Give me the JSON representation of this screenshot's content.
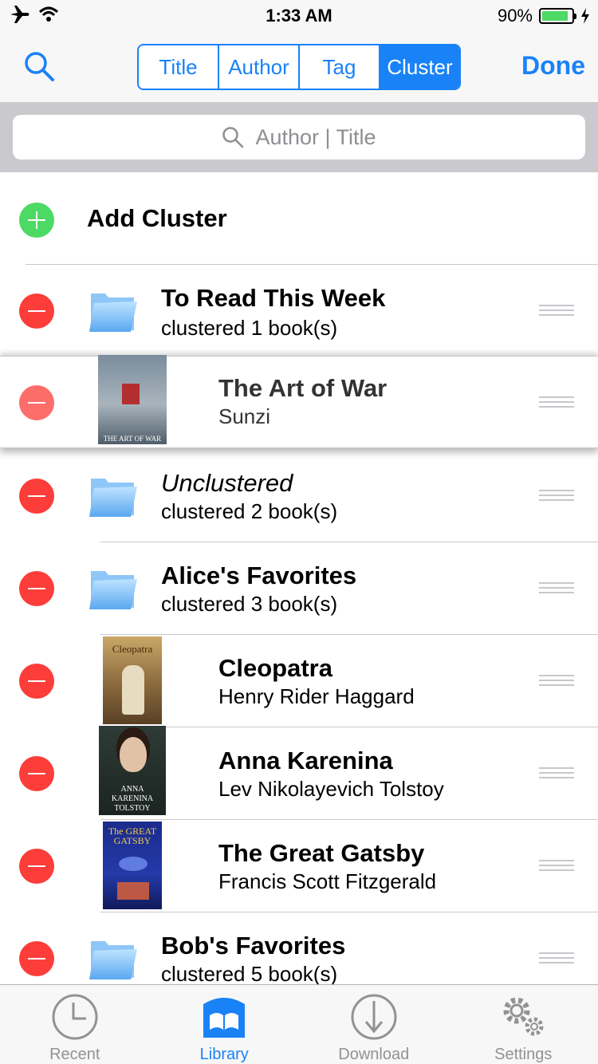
{
  "status": {
    "time": "1:33 AM",
    "battery": "90%",
    "battery_level": 0.9
  },
  "nav": {
    "segments": [
      "Title",
      "Author",
      "Tag",
      "Cluster"
    ],
    "active_segment": "Cluster",
    "done": "Done",
    "accent": "#1a82f7"
  },
  "search": {
    "placeholder": "Author | Title"
  },
  "list": {
    "add_cluster": "Add Cluster",
    "rows": [
      {
        "kind": "cluster",
        "title": "To Read This Week",
        "sub": "clustered 1 book(s)"
      },
      {
        "kind": "book",
        "title": "The Art of War",
        "sub": "Sunzi",
        "cover_text": "THE ART OF WAR"
      },
      {
        "kind": "cluster",
        "title": "Unclustered",
        "sub": "clustered 2 book(s)",
        "italic": true
      },
      {
        "kind": "cluster",
        "title": "Alice's Favorites",
        "sub": "clustered 3 book(s)"
      },
      {
        "kind": "book",
        "title": "Cleopatra",
        "sub": "Henry Rider Haggard",
        "cover_text": "Cleopatra"
      },
      {
        "kind": "book",
        "title": "Anna Karenina",
        "sub": "Lev Nikolayevich Tolstoy",
        "cover_text": "ANNA KARENINA TOLSTOY"
      },
      {
        "kind": "book",
        "title": "The Great Gatsby",
        "sub": "Francis Scott Fitzgerald",
        "cover_text": "The GREAT GATSBY"
      },
      {
        "kind": "cluster",
        "title": "Bob's Favorites",
        "sub": "clustered 5 book(s)"
      }
    ]
  },
  "tabs": [
    {
      "label": "Recent",
      "icon": "clock-icon"
    },
    {
      "label": "Library",
      "icon": "book-icon",
      "active": true
    },
    {
      "label": "Download",
      "icon": "download-icon"
    },
    {
      "label": "Settings",
      "icon": "gear-icon"
    }
  ]
}
